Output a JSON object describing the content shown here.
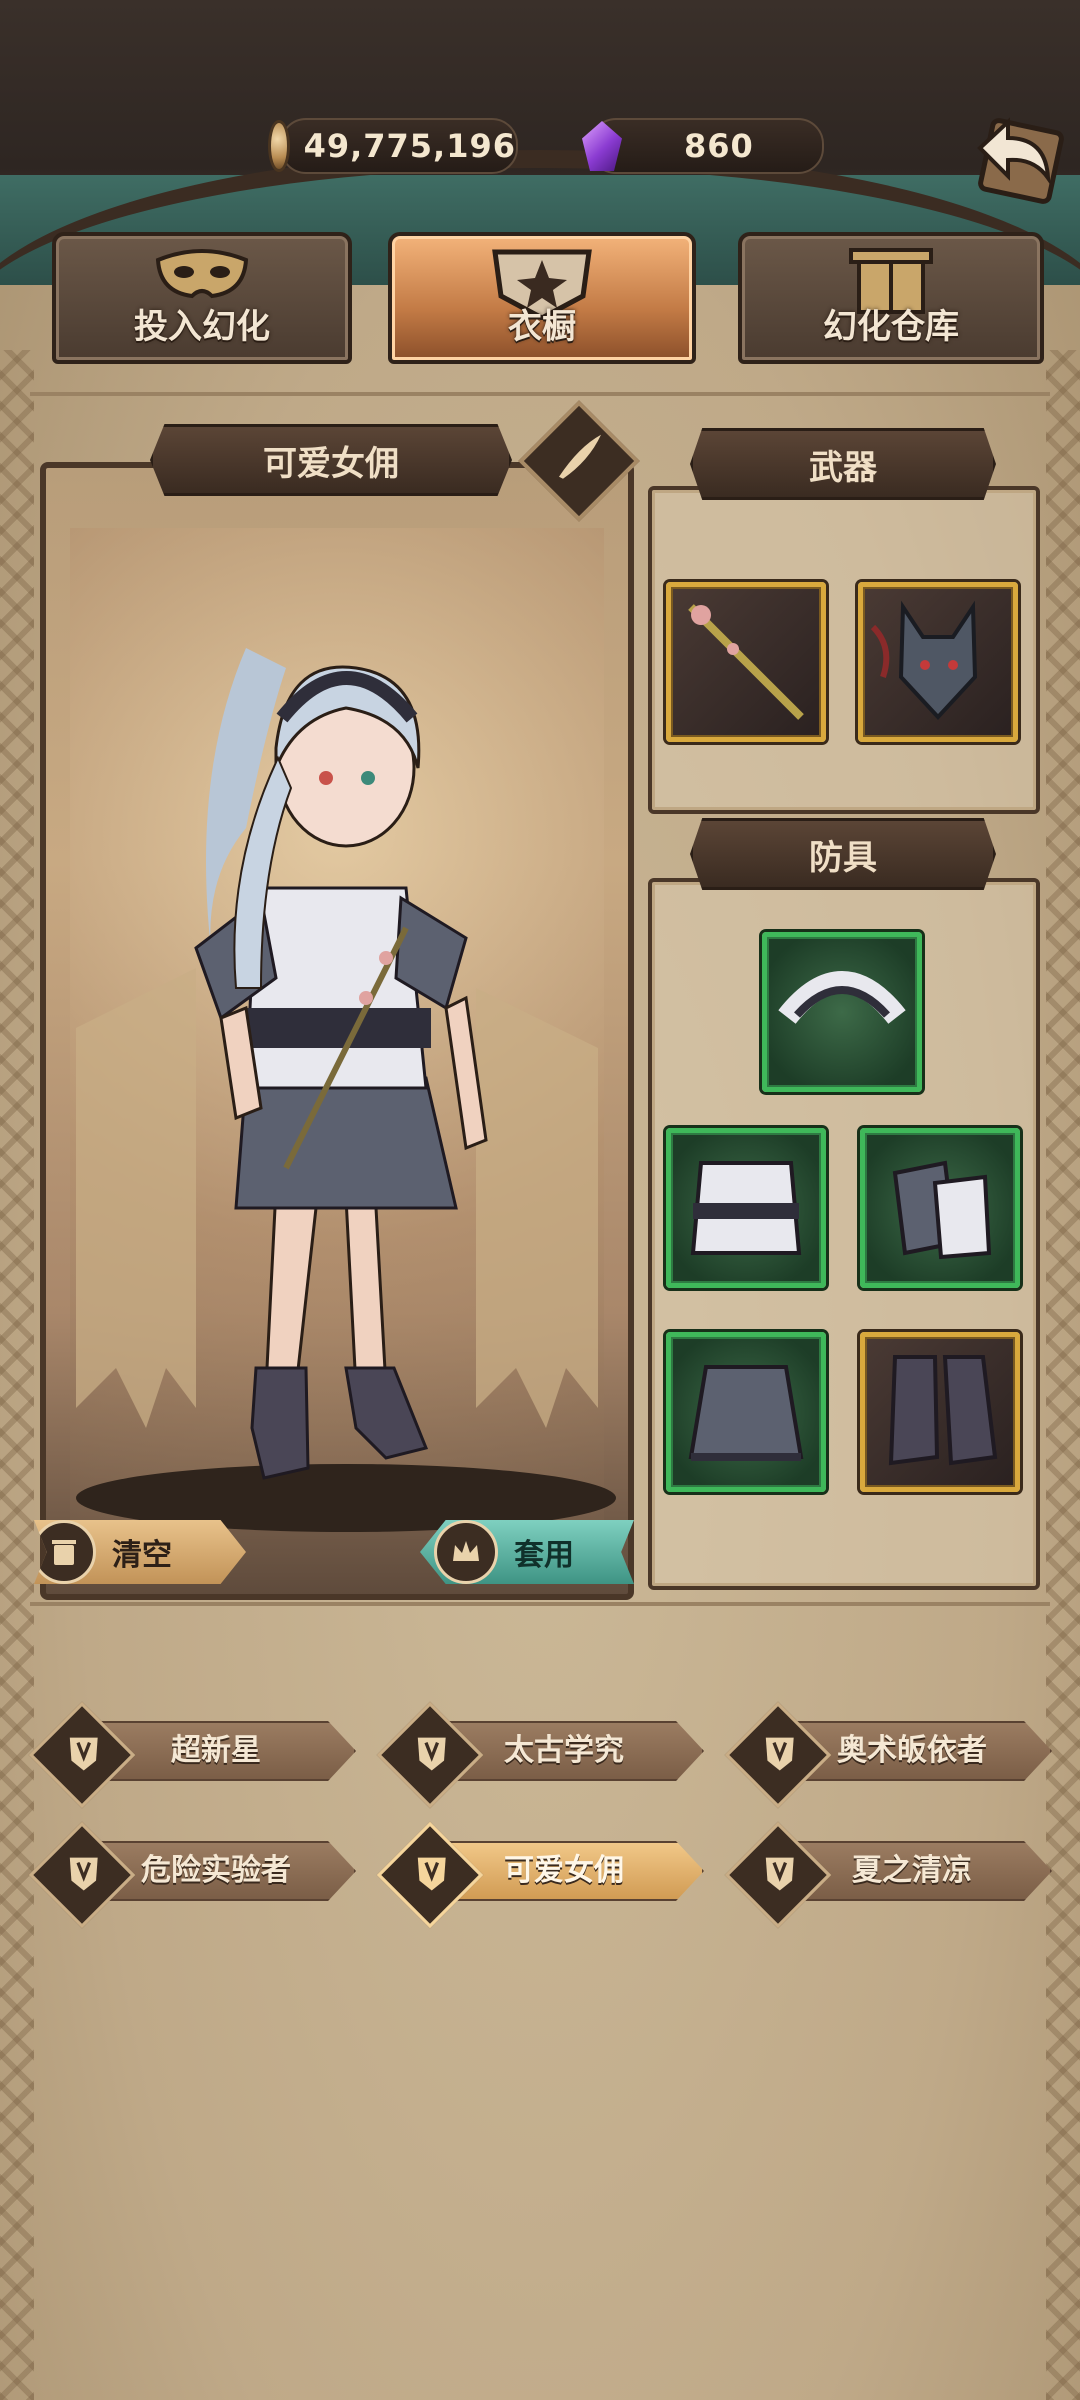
{
  "currency": {
    "gold": "49,775,196",
    "gems": "860"
  },
  "tabs": [
    {
      "label": "投入幻化",
      "active": false
    },
    {
      "label": "衣橱",
      "active": true
    },
    {
      "label": "幻化仓库",
      "active": false
    }
  ],
  "character": {
    "name": "可爱女佣",
    "clear_label": "清空",
    "apply_label": "套用"
  },
  "equipment": {
    "weapon_header": "武器",
    "armor_header": "防具",
    "weapons": [
      {
        "icon": "thorn-staff-icon",
        "rarity": "gold"
      },
      {
        "icon": "wolf-head-icon",
        "rarity": "gold"
      }
    ],
    "armor": [
      {
        "icon": "maid-headdress-icon",
        "rarity": "green"
      },
      {
        "icon": "maid-top-icon",
        "rarity": "green"
      },
      {
        "icon": "maid-gloves-icon",
        "rarity": "green"
      },
      {
        "icon": "skirt-icon",
        "rarity": "green"
      },
      {
        "icon": "boots-icon",
        "rarity": "gold"
      }
    ]
  },
  "outfits": [
    {
      "label": "超新星",
      "selected": false
    },
    {
      "label": "太古学究",
      "selected": false
    },
    {
      "label": "奥术皈依者",
      "selected": false
    },
    {
      "label": "危险实验者",
      "selected": false
    },
    {
      "label": "可爱女佣",
      "selected": true
    },
    {
      "label": "夏之清凉",
      "selected": false
    }
  ],
  "colors": {
    "accent_gold": "#d9a93d",
    "accent_green": "#3fb85a",
    "accent_teal": "#3f9484"
  }
}
